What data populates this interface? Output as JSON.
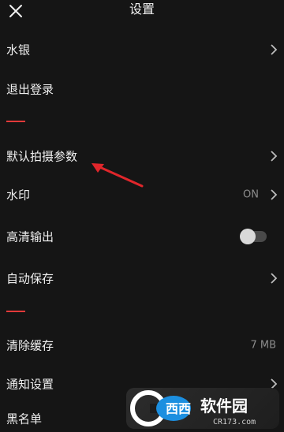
{
  "header": {
    "title": "设置"
  },
  "rows": [
    {
      "label": "水银"
    },
    {
      "label": "退出登录"
    },
    {
      "label": "默认拍摄参数"
    },
    {
      "label": "水印",
      "value": "ON"
    },
    {
      "label": "高清输出",
      "toggle_on": false
    },
    {
      "label": "自动保存"
    },
    {
      "label": "清除缓存",
      "value": "7 MB"
    },
    {
      "label": "通知设置"
    },
    {
      "label": "黑名单"
    }
  ],
  "watermark": {
    "logo_text": "西西软件园",
    "sub_text": "CR173.com"
  },
  "colors": {
    "background": "#151515",
    "accent_red": "#e23a3a",
    "text": "#f0f0f0",
    "muted": "#8c8c8c"
  }
}
